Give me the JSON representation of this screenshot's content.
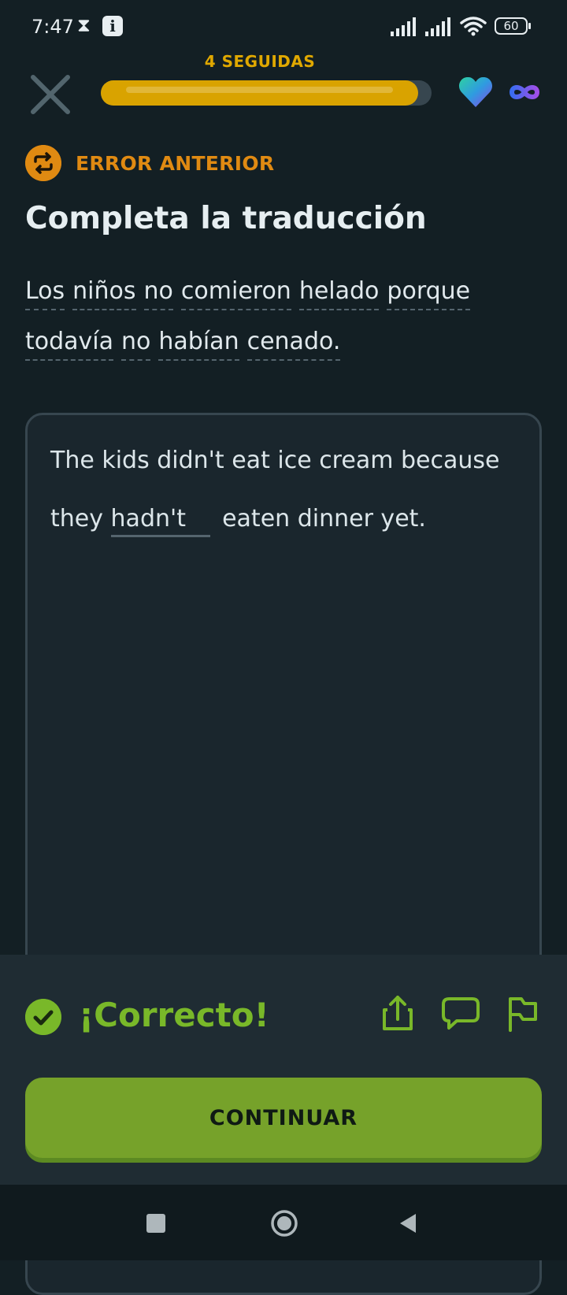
{
  "status_bar": {
    "time": "7:47",
    "battery": "60",
    "icons": [
      "hourglass-icon",
      "info-icon",
      "signal-icon",
      "signal-icon",
      "wifi-icon",
      "battery-icon"
    ]
  },
  "header": {
    "streak": "4 SEGUIDAS",
    "progress": 0.96,
    "progress_color": "#d9a300",
    "icons": [
      "close-icon",
      "heart-icon",
      "infinity-icon"
    ]
  },
  "lesson": {
    "tag": "ERROR ANTERIOR",
    "tag_color": "#e08a12",
    "title": "Completa la traducción",
    "source_words": [
      "Los",
      "niños",
      "no",
      "comieron",
      "helado",
      "porque",
      "todavía",
      "no",
      "habían",
      "cenado."
    ],
    "answer": {
      "line1": "The kids didn't eat ice cream because",
      "before": "they",
      "filled_blank": "hadn't",
      "after": "eaten dinner yet."
    }
  },
  "feedback": {
    "message": "¡Correcto!",
    "color": "#79b829",
    "actions": [
      "share-icon",
      "comment-icon",
      "report-flag-icon"
    ]
  },
  "footer": {
    "continue_label": "CONTINUAR"
  },
  "nav": {
    "icons": [
      "recents-square-icon",
      "home-circle-icon",
      "back-triangle-icon"
    ]
  }
}
